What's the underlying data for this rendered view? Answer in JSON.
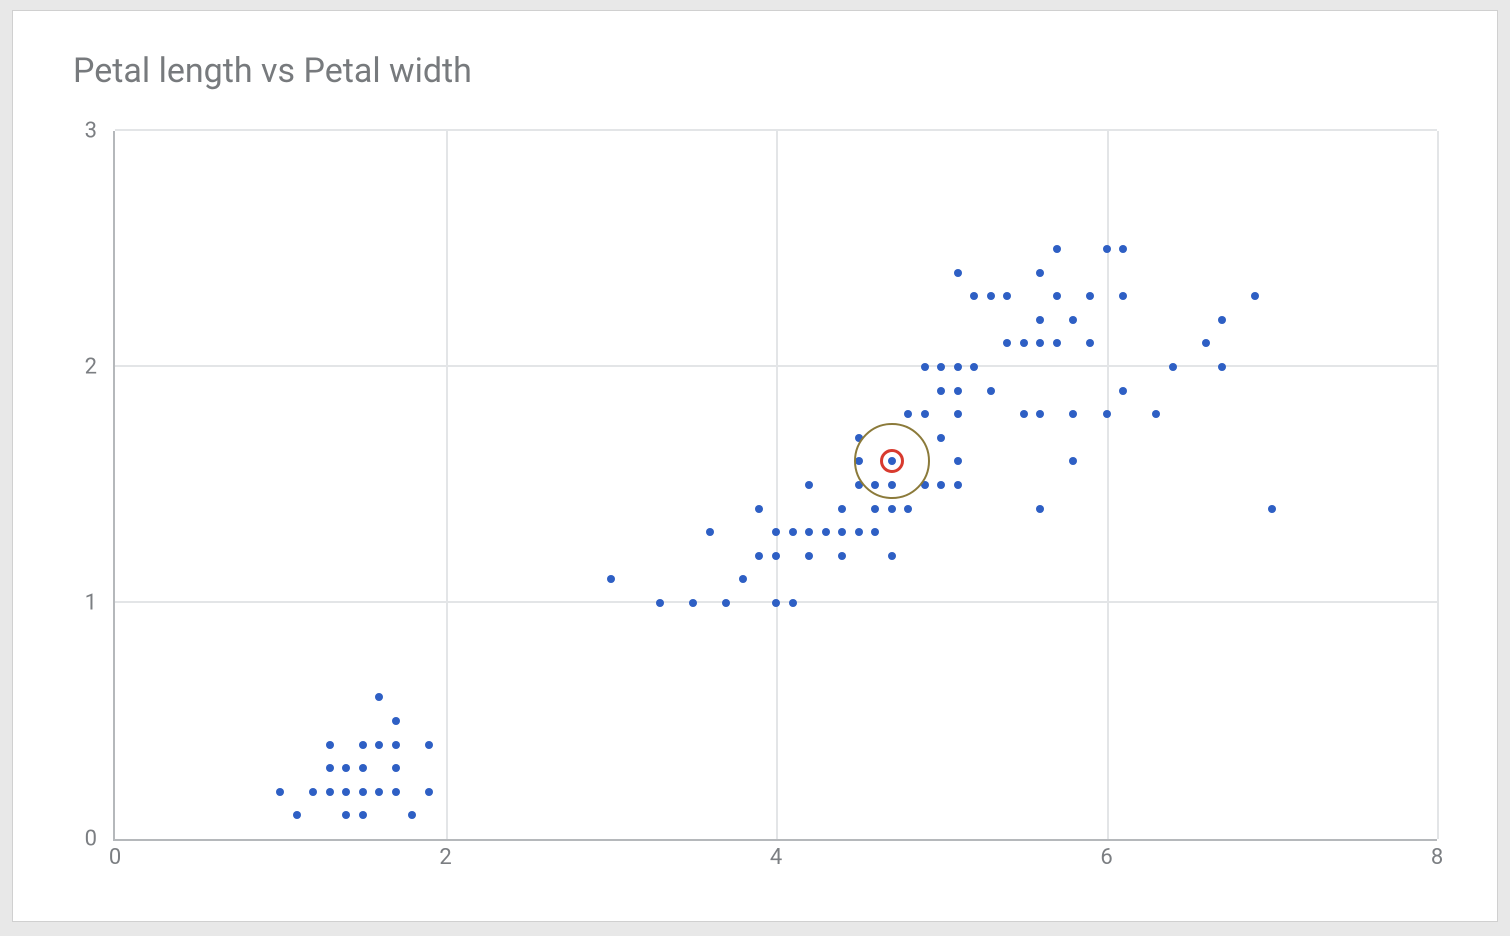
{
  "chart_data": {
    "type": "scatter",
    "title": "Petal length vs Petal width",
    "xlabel": "",
    "ylabel": "",
    "xlim": [
      0,
      8
    ],
    "ylim": [
      0,
      3
    ],
    "x_ticks": [
      0,
      2,
      4,
      6,
      8
    ],
    "y_ticks": [
      0,
      1,
      2,
      3
    ],
    "series": [
      {
        "name": "points",
        "color": "#2e5fc4",
        "xy": [
          [
            1.0,
            0.2
          ],
          [
            1.1,
            0.1
          ],
          [
            1.2,
            0.2
          ],
          [
            1.3,
            0.2
          ],
          [
            1.3,
            0.3
          ],
          [
            1.3,
            0.4
          ],
          [
            1.4,
            0.1
          ],
          [
            1.4,
            0.2
          ],
          [
            1.4,
            0.3
          ],
          [
            1.5,
            0.1
          ],
          [
            1.5,
            0.2
          ],
          [
            1.5,
            0.3
          ],
          [
            1.5,
            0.4
          ],
          [
            1.6,
            0.2
          ],
          [
            1.6,
            0.4
          ],
          [
            1.6,
            0.6
          ],
          [
            1.7,
            0.2
          ],
          [
            1.7,
            0.3
          ],
          [
            1.7,
            0.4
          ],
          [
            1.7,
            0.5
          ],
          [
            1.8,
            0.1
          ],
          [
            1.9,
            0.2
          ],
          [
            1.9,
            0.4
          ],
          [
            3.0,
            1.1
          ],
          [
            3.3,
            1.0
          ],
          [
            3.5,
            1.0
          ],
          [
            3.6,
            1.3
          ],
          [
            3.7,
            1.0
          ],
          [
            3.8,
            1.1
          ],
          [
            3.9,
            1.2
          ],
          [
            3.9,
            1.4
          ],
          [
            4.0,
            1.0
          ],
          [
            4.0,
            1.2
          ],
          [
            4.0,
            1.3
          ],
          [
            4.1,
            1.0
          ],
          [
            4.1,
            1.3
          ],
          [
            4.2,
            1.2
          ],
          [
            4.2,
            1.3
          ],
          [
            4.2,
            1.5
          ],
          [
            4.3,
            1.3
          ],
          [
            4.4,
            1.2
          ],
          [
            4.4,
            1.3
          ],
          [
            4.4,
            1.4
          ],
          [
            4.5,
            1.3
          ],
          [
            4.5,
            1.5
          ],
          [
            4.5,
            1.6
          ],
          [
            4.5,
            1.7
          ],
          [
            4.6,
            1.3
          ],
          [
            4.6,
            1.4
          ],
          [
            4.6,
            1.5
          ],
          [
            4.7,
            1.2
          ],
          [
            4.7,
            1.4
          ],
          [
            4.7,
            1.5
          ],
          [
            4.7,
            1.6
          ],
          [
            4.8,
            1.4
          ],
          [
            4.8,
            1.8
          ],
          [
            4.9,
            1.5
          ],
          [
            4.9,
            1.8
          ],
          [
            4.9,
            2.0
          ],
          [
            5.0,
            1.5
          ],
          [
            5.0,
            1.7
          ],
          [
            5.0,
            1.9
          ],
          [
            5.0,
            2.0
          ],
          [
            5.1,
            1.5
          ],
          [
            5.1,
            1.6
          ],
          [
            5.1,
            1.8
          ],
          [
            5.1,
            1.9
          ],
          [
            5.1,
            2.0
          ],
          [
            5.1,
            2.4
          ],
          [
            5.2,
            2.0
          ],
          [
            5.2,
            2.3
          ],
          [
            5.3,
            1.9
          ],
          [
            5.3,
            2.3
          ],
          [
            5.4,
            2.1
          ],
          [
            5.4,
            2.3
          ],
          [
            5.5,
            1.8
          ],
          [
            5.5,
            2.1
          ],
          [
            5.6,
            1.4
          ],
          [
            5.6,
            1.8
          ],
          [
            5.6,
            2.1
          ],
          [
            5.6,
            2.2
          ],
          [
            5.6,
            2.4
          ],
          [
            5.7,
            2.1
          ],
          [
            5.7,
            2.3
          ],
          [
            5.7,
            2.5
          ],
          [
            5.8,
            1.6
          ],
          [
            5.8,
            1.8
          ],
          [
            5.8,
            2.2
          ],
          [
            5.9,
            2.1
          ],
          [
            5.9,
            2.3
          ],
          [
            6.0,
            1.8
          ],
          [
            6.0,
            2.5
          ],
          [
            6.1,
            1.9
          ],
          [
            6.1,
            2.3
          ],
          [
            6.1,
            2.5
          ],
          [
            6.3,
            1.8
          ],
          [
            6.4,
            2.0
          ],
          [
            6.6,
            2.1
          ],
          [
            6.7,
            2.0
          ],
          [
            6.7,
            2.2
          ],
          [
            6.9,
            2.3
          ],
          [
            7.0,
            1.4
          ]
        ]
      },
      {
        "name": "selected",
        "style": "ring2",
        "colors": {
          "inner": "#d83a2e",
          "outer": "#8b7a3a"
        },
        "xy": [
          [
            4.7,
            1.6
          ]
        ]
      }
    ]
  },
  "colors": {
    "point": "#2e5fc4",
    "ring_inner": "#d83a2e",
    "ring_outer": "#8b7a3a"
  }
}
